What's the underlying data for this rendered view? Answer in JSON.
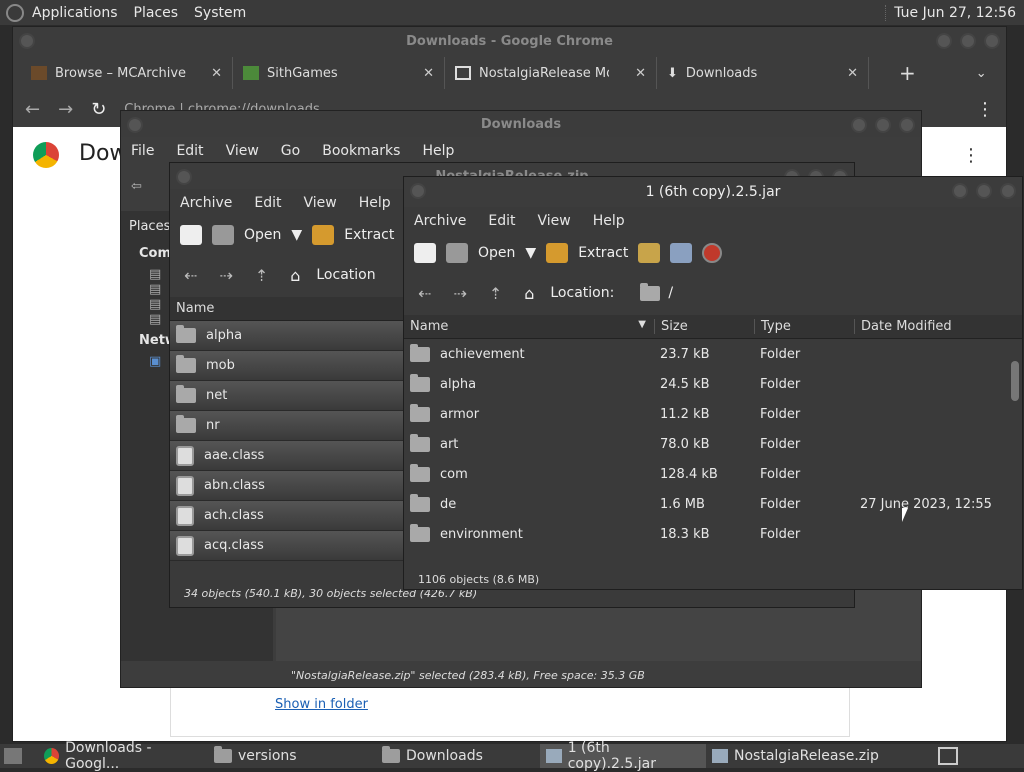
{
  "panel": {
    "menus": [
      "Applications",
      "Places",
      "System"
    ],
    "clock": "Tue Jun 27, 12:56"
  },
  "chrome": {
    "title": "Downloads - Google Chrome",
    "tabs": [
      "Browse – MCArchive",
      "SithGames",
      "NostalgiaRelease Mod Ar",
      "Downloads"
    ],
    "address": "Chrome | chrome://downloads",
    "page_title": "Dow",
    "show_in_folder": "Show in folder"
  },
  "fm": {
    "title": "Downloads",
    "menus": [
      "File",
      "Edit",
      "View",
      "Go",
      "Bookmarks",
      "Help"
    ],
    "places_label": "Places",
    "computer_label": "Com",
    "network_label": "Netw",
    "status": "\"NostalgiaRelease.zip\" selected (283.4 kB), Free space: 35.3 GB"
  },
  "back_archive": {
    "title": "NostalgiaRelease.zip",
    "menus": [
      "Archive",
      "Edit",
      "View",
      "Help"
    ],
    "open_label": "Open",
    "extract_label": "Extract",
    "location_label": "Location",
    "col_name": "Name",
    "rows": [
      {
        "name": "alpha",
        "kind": "folder"
      },
      {
        "name": "mob",
        "kind": "folder"
      },
      {
        "name": "net",
        "kind": "folder"
      },
      {
        "name": "nr",
        "kind": "folder"
      },
      {
        "name": "aae.class",
        "kind": "class"
      },
      {
        "name": "abn.class",
        "kind": "class"
      },
      {
        "name": "ach.class",
        "kind": "class"
      },
      {
        "name": "acq.class",
        "kind": "class"
      }
    ],
    "status": "34 objects (540.1 kB), 30 objects selected (426.7 kB)"
  },
  "front_archive": {
    "title": "1 (6th copy).2.5.jar",
    "menus": [
      "Archive",
      "Edit",
      "View",
      "Help"
    ],
    "open_label": "Open",
    "extract_label": "Extract",
    "location_label": "Location:",
    "location_value": "/",
    "cols": [
      "Name",
      "Size",
      "Type",
      "Date Modified"
    ],
    "rows": [
      {
        "name": "achievement",
        "size": "23.7 kB",
        "type": "Folder",
        "date": ""
      },
      {
        "name": "alpha",
        "size": "24.5 kB",
        "type": "Folder",
        "date": ""
      },
      {
        "name": "armor",
        "size": "11.2 kB",
        "type": "Folder",
        "date": ""
      },
      {
        "name": "art",
        "size": "78.0 kB",
        "type": "Folder",
        "date": ""
      },
      {
        "name": "com",
        "size": "128.4 kB",
        "type": "Folder",
        "date": ""
      },
      {
        "name": "de",
        "size": "1.6 MB",
        "type": "Folder",
        "date": "27 June 2023, 12:55"
      },
      {
        "name": "environment",
        "size": "18.3 kB",
        "type": "Folder",
        "date": ""
      }
    ],
    "status": "1106 objects (8.6 MB)"
  },
  "taskbar": [
    "Downloads - Googl...",
    "versions",
    "Downloads",
    "1 (6th copy).2.5.jar",
    "NostalgiaRelease.zip"
  ]
}
